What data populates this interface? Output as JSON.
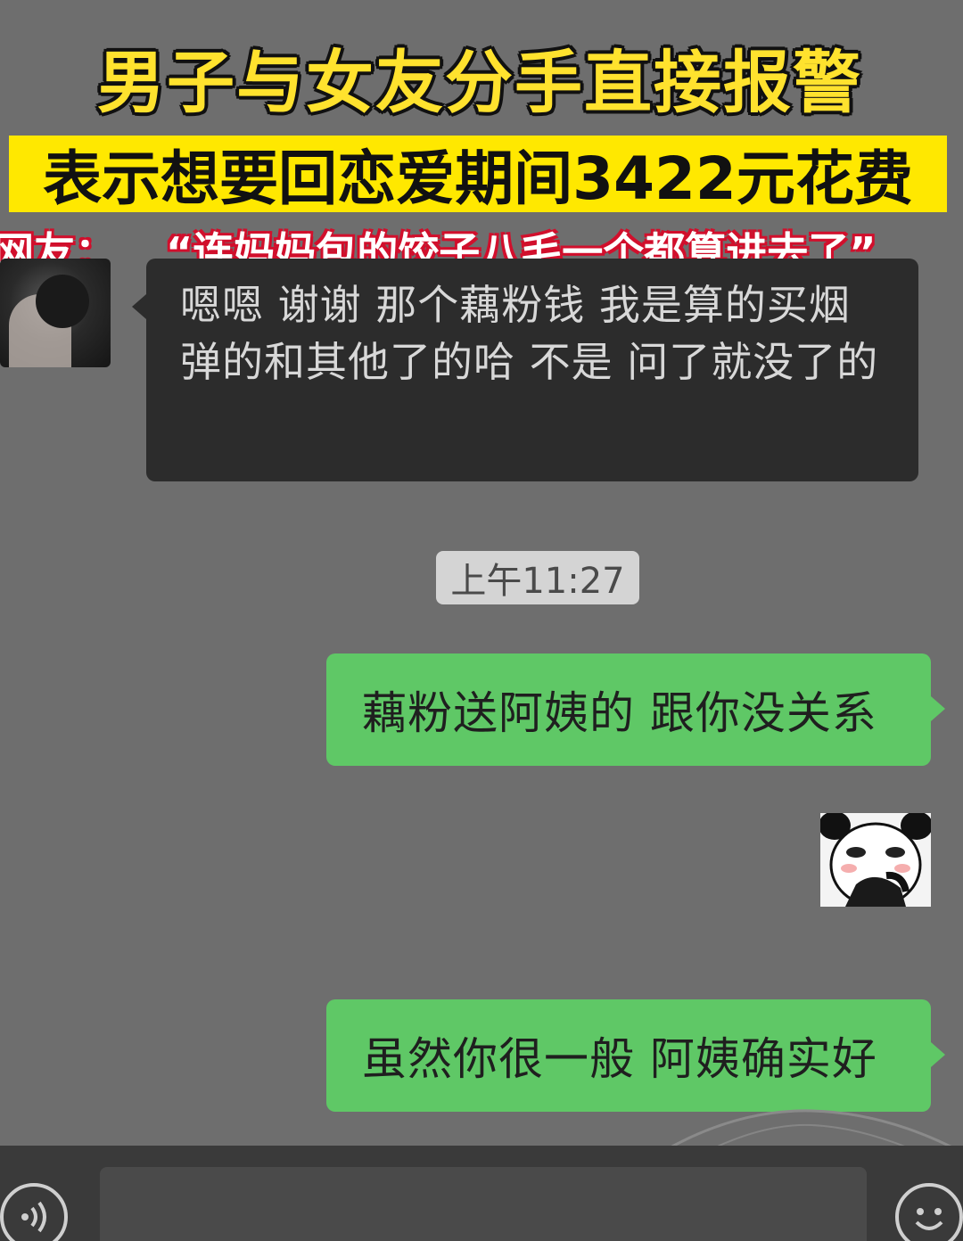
{
  "overlay": {
    "headline_line1": "男子与女友分手直接报警",
    "headline_line2": "表示想要回恋爱期间3422元花费",
    "netizen_label": "网友：",
    "netizen_quote": "“连妈妈包的饺子八毛一个都算进去了”"
  },
  "chat": {
    "incoming_message": "嗯嗯 谢谢 那个藕粉钱 我是算的买烟弹的和其他了的哈 不是 问了就没了的",
    "timestamp": "上午11:27",
    "outgoing_messages": [
      "藕粉送阿姨的 跟你没关系",
      "虽然你很一般 阿姨确实好"
    ],
    "sticker": "panda-meme-sticker"
  },
  "input_bar": {
    "voice_icon": "voice-icon",
    "emoji_icon": "emoji-icon",
    "input_value": ""
  },
  "colors": {
    "headline_yellow": "#ffe22e",
    "banner_yellow": "#ffe800",
    "netizen_red": "#d10f2c",
    "chat_background": "#6e6e6e",
    "incoming_bubble": "#2c2c2c",
    "outgoing_bubble": "#5fc866"
  }
}
